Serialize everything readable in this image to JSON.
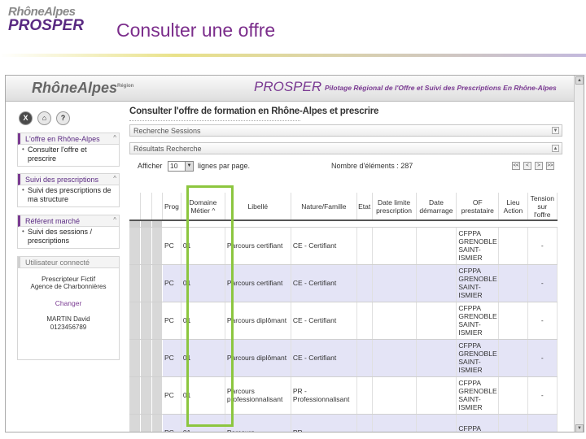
{
  "slide": {
    "logo_region": "RhôneAlpes",
    "logo_product": "PROSPER",
    "title": "Consulter une offre"
  },
  "app": {
    "banner_logo": "RhôneAlpes",
    "banner_logo_small": "Région",
    "banner_product": "PROSPER",
    "banner_subtitle": "Pilotage Régional de l'Offre et Suivi des Prescriptions En Rhône-Alpes"
  },
  "tools": [
    "X",
    "⌂",
    "?"
  ],
  "sidebar": {
    "offre": {
      "title": "L'offre en Rhône-Alpes",
      "caret": "^",
      "items": [
        "Consulter l'offre et prescrire"
      ]
    },
    "suivi": {
      "title": "Suivi des prescriptions",
      "caret": "^",
      "items": [
        "Suivi des prescriptions de ma structure"
      ]
    },
    "referent": {
      "title": "Référent marché",
      "caret": "^",
      "items": [
        "Suivi des sessions / prescriptions"
      ]
    },
    "user": {
      "title": "Utilisateur connecté",
      "role": "Prescripteur Fictif",
      "agency": "Agence de Charbonnières",
      "change_label": "Changer",
      "name": "MARTIN David",
      "phone": "0123456789"
    }
  },
  "main": {
    "title": "Consulter l'offre de formation en Rhône-Alpes et prescrire",
    "search_sessions": "Recherche Sessions",
    "search_results": "Résultats Recherche",
    "show_label": "Afficher",
    "page_size": "10",
    "per_page_label": "lignes par page.",
    "count_label": "Nombre d'éléments : 287",
    "nav_buttons": [
      "<<",
      "<",
      ">",
      ">>"
    ]
  },
  "table": {
    "headers": {
      "prog": "Prog",
      "domaine": "Domaine Métier",
      "sort": "^",
      "libelle": "Libellé",
      "nature": "Nature/Famille",
      "etat": "Etat",
      "date_limite": "Date limite prescription",
      "date_demarrage": "Date démarrage",
      "of": "OF prestataire",
      "lieu": "Lieu Action",
      "tension": "Tension sur l'offre"
    },
    "rows": [
      {
        "prog": "PC",
        "domaine": "01",
        "libelle": "Parcours certifiant",
        "nature": "CE - Certifiant",
        "of": "CFPPA GRENOBLE SAINT-ISMIER",
        "tension": "-"
      },
      {
        "prog": "PC",
        "domaine": "01",
        "libelle": "Parcours certifiant",
        "nature": "CE - Certifiant",
        "of": "CFPPA GRENOBLE SAINT-ISMIER",
        "tension": "-"
      },
      {
        "prog": "PC",
        "domaine": "01",
        "libelle": "Parcours diplômant",
        "nature": "CE - Certifiant",
        "of": "CFPPA GRENOBLE SAINT-ISMIER",
        "tension": "-"
      },
      {
        "prog": "PC",
        "domaine": "01",
        "libelle": "Parcours diplômant",
        "nature": "CE - Certifiant",
        "of": "CFPPA GRENOBLE SAINT-ISMIER",
        "tension": "-"
      },
      {
        "prog": "PC",
        "domaine": "01",
        "libelle": "Parcours professionnalisant",
        "nature": "PR - Professionnalisant",
        "of": "CFPPA GRENOBLE SAINT-ISMIER",
        "tension": "-"
      },
      {
        "prog": "PC",
        "domaine": "01",
        "libelle": "Parcours",
        "nature": "PR",
        "of": "CFPPA GRENOBLE",
        "tension": ""
      }
    ]
  }
}
